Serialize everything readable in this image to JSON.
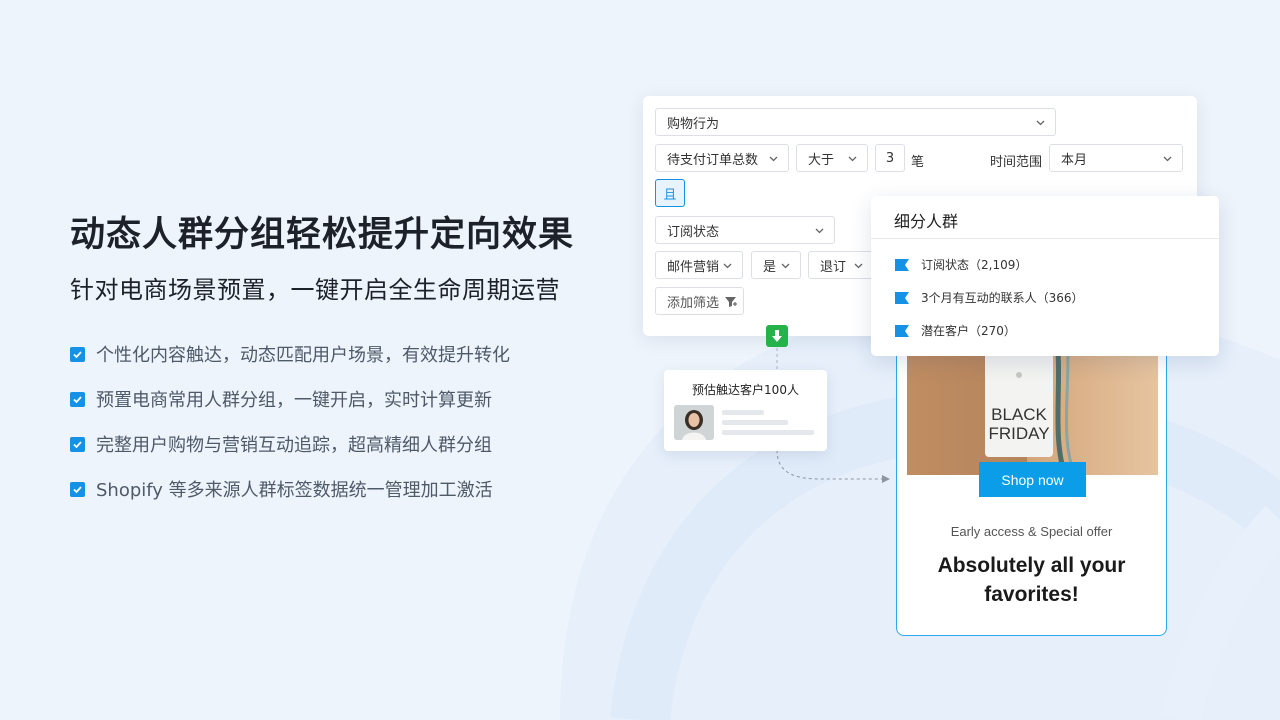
{
  "hero": {
    "headline": "动态人群分组轻松提升定向效果",
    "subhead": "针对电商场景预置，一键开启全生命周期运营"
  },
  "features": [
    "个性化内容触达，动态匹配用户场景，有效提升转化",
    "预置电商常用人群分组，一键开启，实时计算更新",
    "完整用户购物与营销互动追踪，超高精细人群分组",
    "Shopify 等多来源人群标签数据统一管理加工激活"
  ],
  "filter_panel": {
    "category_select": "购物行为",
    "metric_select": "待支付订单总数",
    "operator_select": "大于",
    "count_value": "3",
    "count_unit": "笔",
    "time_range_label": "时间范围",
    "time_range_select": "本月",
    "and_tag": "且",
    "status_select": "订阅状态",
    "channel_select": "邮件营销",
    "yes_select": "是",
    "unsub_select": "退订",
    "add_filter_label": "添加筛选"
  },
  "estimate": {
    "title": "预估触达客户100人"
  },
  "segments": {
    "title": "细分人群",
    "items": [
      "订阅状态（2,109）",
      "3个月有互动的联系人（366）",
      "潜在客户（270）"
    ]
  },
  "email": {
    "tag_line1": "BLACK",
    "tag_line2": "FRIDAY",
    "shop_button": "Shop now",
    "early_access": "Early access & Special offer",
    "headline": "Absolutely all your favorites!"
  },
  "colors": {
    "accent": "#1592e6",
    "email_border": "#2ea7ee",
    "shop_button": "#0b9de8",
    "arrow_green": "#24b24a",
    "background": "#eef4fb"
  }
}
